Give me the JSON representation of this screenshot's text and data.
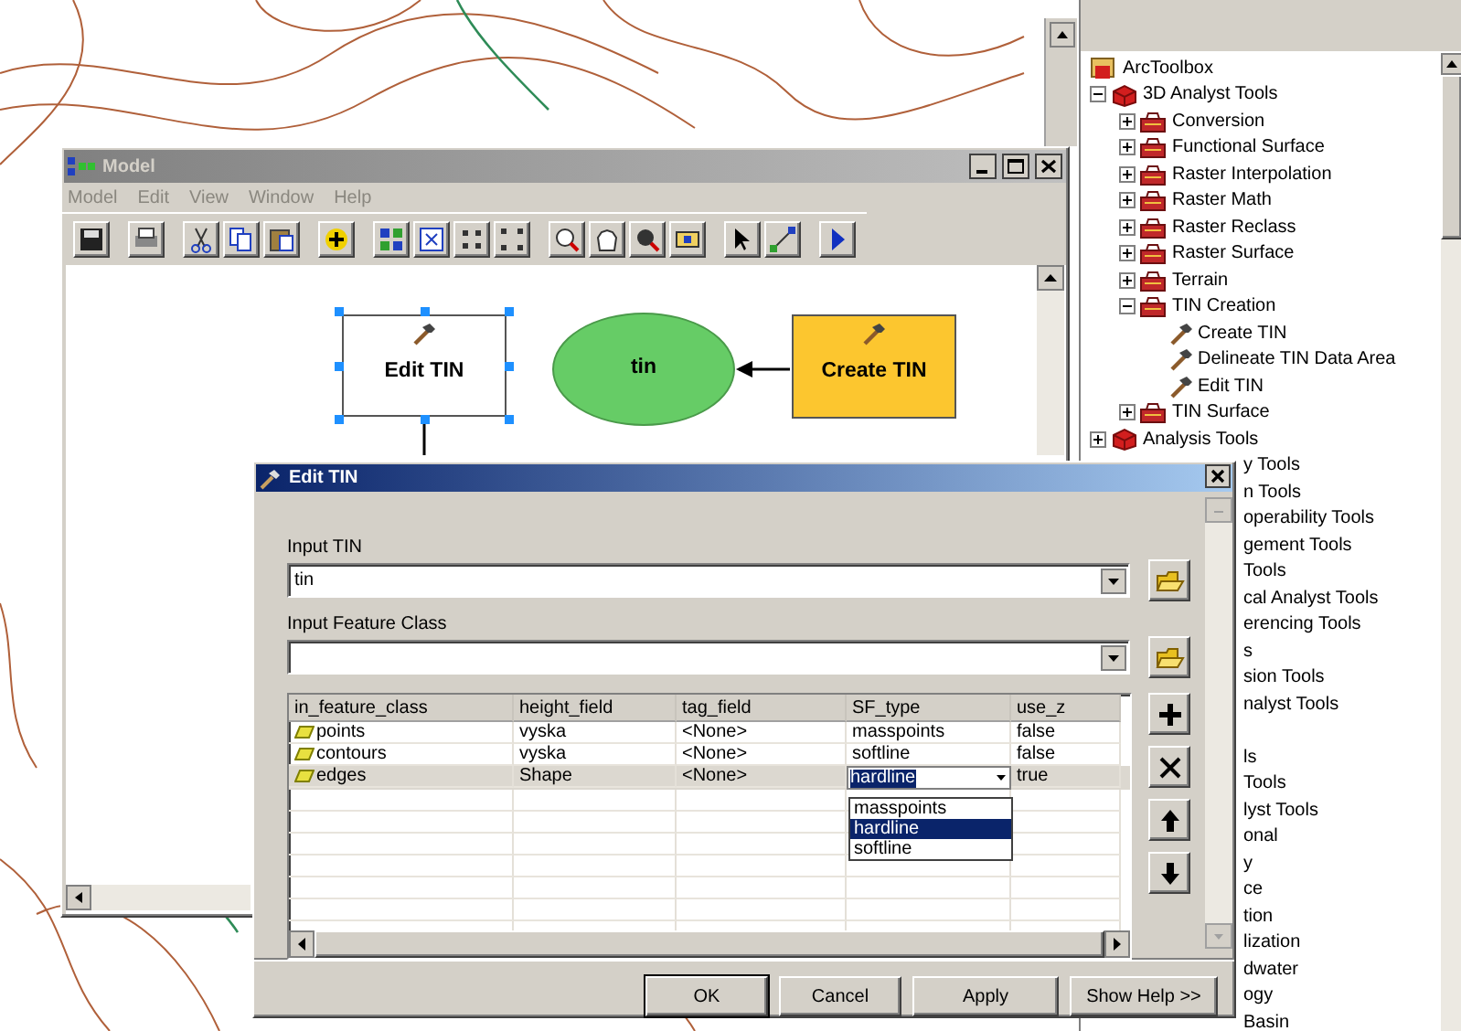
{
  "model_window": {
    "title": "Model",
    "menu": [
      "Model",
      "Edit",
      "View",
      "Window",
      "Help"
    ],
    "diagram": {
      "nodes": [
        {
          "label": "Edit TIN",
          "kind": "tool",
          "selected": true,
          "color": "#ffffff"
        },
        {
          "label": "tin",
          "kind": "data",
          "selected": false,
          "color": "#66cc66"
        },
        {
          "label": "Create TIN",
          "kind": "tool",
          "selected": false,
          "color": "#fcc62f"
        }
      ]
    }
  },
  "dialog": {
    "title": "Edit TIN",
    "fields": [
      {
        "label": "Input TIN",
        "value": "tin"
      },
      {
        "label": "Input Feature Class"
      }
    ],
    "table": {
      "columns": [
        {
          "label": "in_feature_class",
          "kind": "layer"
        },
        {
          "label": "height_field",
          "kind": "text"
        },
        {
          "label": "tag_field",
          "kind": "text"
        },
        {
          "label": "SF_type",
          "kind": "choice"
        },
        {
          "label": "use_z",
          "kind": "text"
        }
      ],
      "rows": [
        {
          "cells": [
            "points",
            "vyska",
            "<None>",
            "masspoints",
            "false"
          ],
          "selected": false
        },
        {
          "cells": [
            "contours",
            "vyska",
            "<None>",
            "softline",
            "false"
          ],
          "selected": false
        },
        {
          "cells": [
            "edges",
            "Shape",
            "<None>",
            "hardline",
            "true"
          ],
          "selected": true,
          "open_list": [
            {
              "label": "masspoints",
              "selected": false
            },
            {
              "label": "hardline",
              "selected": true
            },
            {
              "label": "softline",
              "selected": false
            }
          ]
        }
      ]
    },
    "buttons": [
      {
        "label": "OK",
        "default": true
      },
      {
        "label": "Cancel",
        "default": false
      },
      {
        "label": "Apply",
        "default": false
      },
      {
        "label": "Show Help >>",
        "default": false
      }
    ]
  },
  "toolbox_tree": {
    "root": "ArcToolbox",
    "items": [
      {
        "label": "3D Analyst Tools",
        "kind": "toolbox",
        "expanded": true,
        "children": [
          {
            "label": "Conversion",
            "kind": "toolset",
            "expanded": false
          },
          {
            "label": "Functional Surface",
            "kind": "toolset",
            "expanded": false
          },
          {
            "label": "Raster Interpolation",
            "kind": "toolset",
            "expanded": false
          },
          {
            "label": "Raster Math",
            "kind": "toolset",
            "expanded": false
          },
          {
            "label": "Raster Reclass",
            "kind": "toolset",
            "expanded": false
          },
          {
            "label": "Raster Surface",
            "kind": "toolset",
            "expanded": false
          },
          {
            "label": "Terrain",
            "kind": "toolset",
            "expanded": false
          },
          {
            "label": "TIN Creation",
            "kind": "toolset",
            "expanded": true,
            "children": [
              {
                "label": "Create TIN",
                "kind": "tool"
              },
              {
                "label": "Delineate TIN Data Area",
                "kind": "tool"
              },
              {
                "label": "Edit TIN",
                "kind": "tool"
              }
            ]
          },
          {
            "label": "TIN Surface",
            "kind": "toolset",
            "expanded": false
          }
        ]
      },
      {
        "label": "Analysis Tools",
        "kind": "toolbox",
        "expanded": false
      }
    ],
    "partly_hidden_items": [
      {
        "label": "y Tools",
        "after_hidden_row": false
      },
      {
        "label": "n Tools",
        "after_hidden_row": false
      },
      {
        "label": "operability Tools",
        "after_hidden_row": false
      },
      {
        "label": "gement Tools",
        "after_hidden_row": false
      },
      {
        "label": "Tools",
        "after_hidden_row": false
      },
      {
        "label": "cal Analyst Tools",
        "after_hidden_row": false
      },
      {
        "label": "erencing Tools",
        "after_hidden_row": false
      },
      {
        "label": "s",
        "after_hidden_row": false
      },
      {
        "label": "sion Tools",
        "after_hidden_row": false
      },
      {
        "label": "nalyst Tools",
        "after_hidden_row": false
      },
      {
        "label": "ls",
        "after_hidden_row": true
      },
      {
        "label": "Tools",
        "after_hidden_row": false
      },
      {
        "label": "lyst Tools",
        "after_hidden_row": false
      },
      {
        "label": "onal",
        "after_hidden_row": false
      },
      {
        "label": "y",
        "after_hidden_row": false
      },
      {
        "label": "ce",
        "after_hidden_row": false
      },
      {
        "label": "tion",
        "after_hidden_row": false
      },
      {
        "label": "lization",
        "after_hidden_row": false
      },
      {
        "label": "dwater",
        "after_hidden_row": false
      },
      {
        "label": "ogy",
        "after_hidden_row": false
      },
      {
        "label": "Basin",
        "after_hidden_row": false
      }
    ]
  }
}
